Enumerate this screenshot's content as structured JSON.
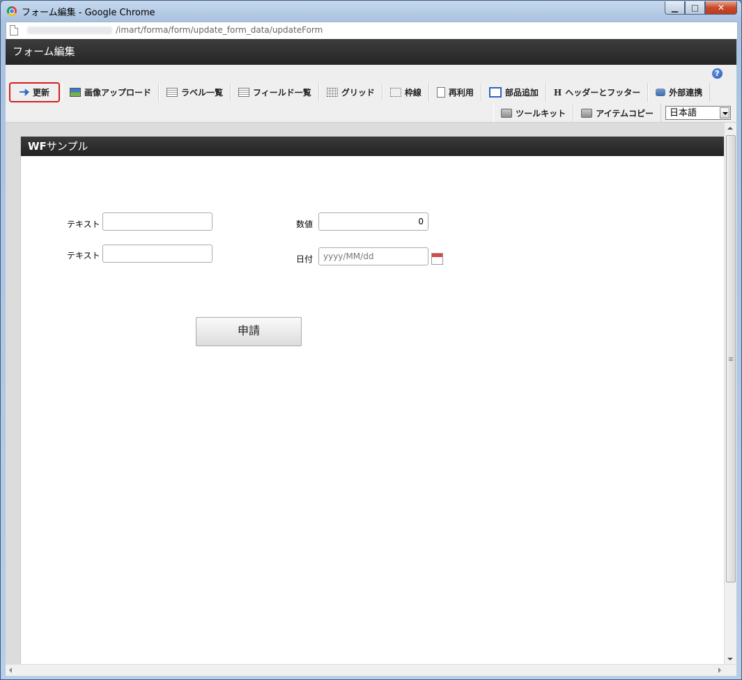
{
  "window": {
    "title": "フォーム編集 - Google Chrome",
    "min_glyph": "▁",
    "max_glyph": "□",
    "close_glyph": "✕"
  },
  "address": {
    "url": "/imart/forma/form/update_form_data/updateForm"
  },
  "app": {
    "title": "フォーム編集",
    "help_glyph": "?"
  },
  "toolbar": {
    "row1": [
      {
        "label": "更新",
        "icon": "update-icon"
      },
      {
        "label": "画像アップロード",
        "icon": "image-upload-icon"
      },
      {
        "label": "ラベル一覧",
        "icon": "list-icon"
      },
      {
        "label": "フィールド一覧",
        "icon": "list-icon"
      },
      {
        "label": "グリッド",
        "icon": "grid-icon"
      },
      {
        "label": "枠線",
        "icon": "border-icon"
      },
      {
        "label": "再利用",
        "icon": "reuse-icon"
      },
      {
        "label": "部品追加",
        "icon": "add-part-icon"
      },
      {
        "label": "ヘッダーとフッター",
        "icon": "header-footer-icon",
        "glyph": "H"
      },
      {
        "label": "外部連携",
        "icon": "external-link-icon"
      }
    ],
    "row2": [
      {
        "label": "ツールキット",
        "icon": "toolkit-icon"
      },
      {
        "label": "アイテムコピー",
        "icon": "toolkit-icon"
      }
    ],
    "language": "日本語"
  },
  "form": {
    "title_bold": "WF",
    "title_rest": "サンプル",
    "fields": {
      "text1_label": "テキスト",
      "text1_value": "",
      "text2_label": "テキスト",
      "text2_value": "",
      "number_label": "数値",
      "number_value": "0",
      "date_label": "日付",
      "date_placeholder": "yyyy/MM/dd"
    },
    "submit_label": "申請"
  }
}
